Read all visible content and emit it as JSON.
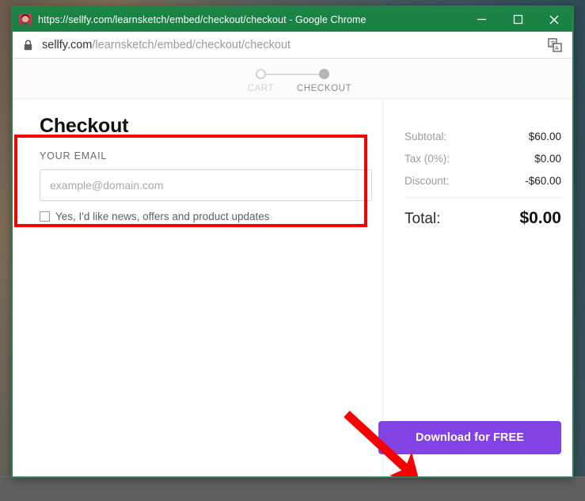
{
  "browser": {
    "window_title": "https://sellfy.com/learnsketch/embed/checkout/checkout - Google Chrome",
    "favicon_name": "sellfy-avatar-favicon",
    "url_host": "sellfy.com",
    "url_path": "/learnsketch/embed/checkout/checkout",
    "lock_icon": "lock-icon",
    "translate_icon": "translate-icon",
    "minimize_label": "Minimize",
    "maximize_label": "Maximize",
    "close_label": "Close",
    "titlebar_color": "#1a8243"
  },
  "steps": [
    {
      "label": "CART",
      "state": "todo"
    },
    {
      "label": "CHECKOUT",
      "state": "active"
    }
  ],
  "checkout": {
    "title": "Checkout",
    "email_label": "YOUR EMAIL",
    "email_value": "",
    "email_placeholder": "example@domain.com",
    "newsletter_label": "Yes, I'd like news, offers and product updates",
    "newsletter_checked": false
  },
  "summary": {
    "rows": [
      {
        "label": "Subtotal:",
        "value": "$60.00"
      },
      {
        "label": "Tax (0%):",
        "value": "$0.00"
      },
      {
        "label": "Discount:",
        "value": "-$60.00"
      }
    ],
    "total_label": "Total:",
    "total_value": "$0.00"
  },
  "cta": {
    "label": "Download for FREE",
    "color": "#8342e3"
  },
  "annotations": {
    "highlight_color": "#f70000",
    "rect_target": "your-email-section",
    "arrow_target": "download-for-free-button"
  }
}
